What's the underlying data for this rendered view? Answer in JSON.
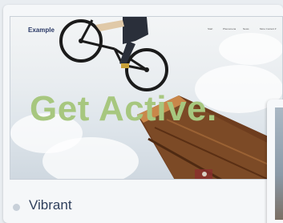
{
  "preview": {
    "logo": "Example",
    "nav": [
      "Start",
      "Phenomena",
      "News",
      "More Content ▾"
    ],
    "headline": "Get Active.",
    "image_subject": "bmx-rider-over-wooden-ramp"
  },
  "caption": "Vibrant",
  "colors": {
    "headline": "#a7c77f",
    "logo": "#2b3a67",
    "caption": "#2e3f5c",
    "card_bg": "#f5f7f9",
    "page_bg": "#e9edf1"
  }
}
